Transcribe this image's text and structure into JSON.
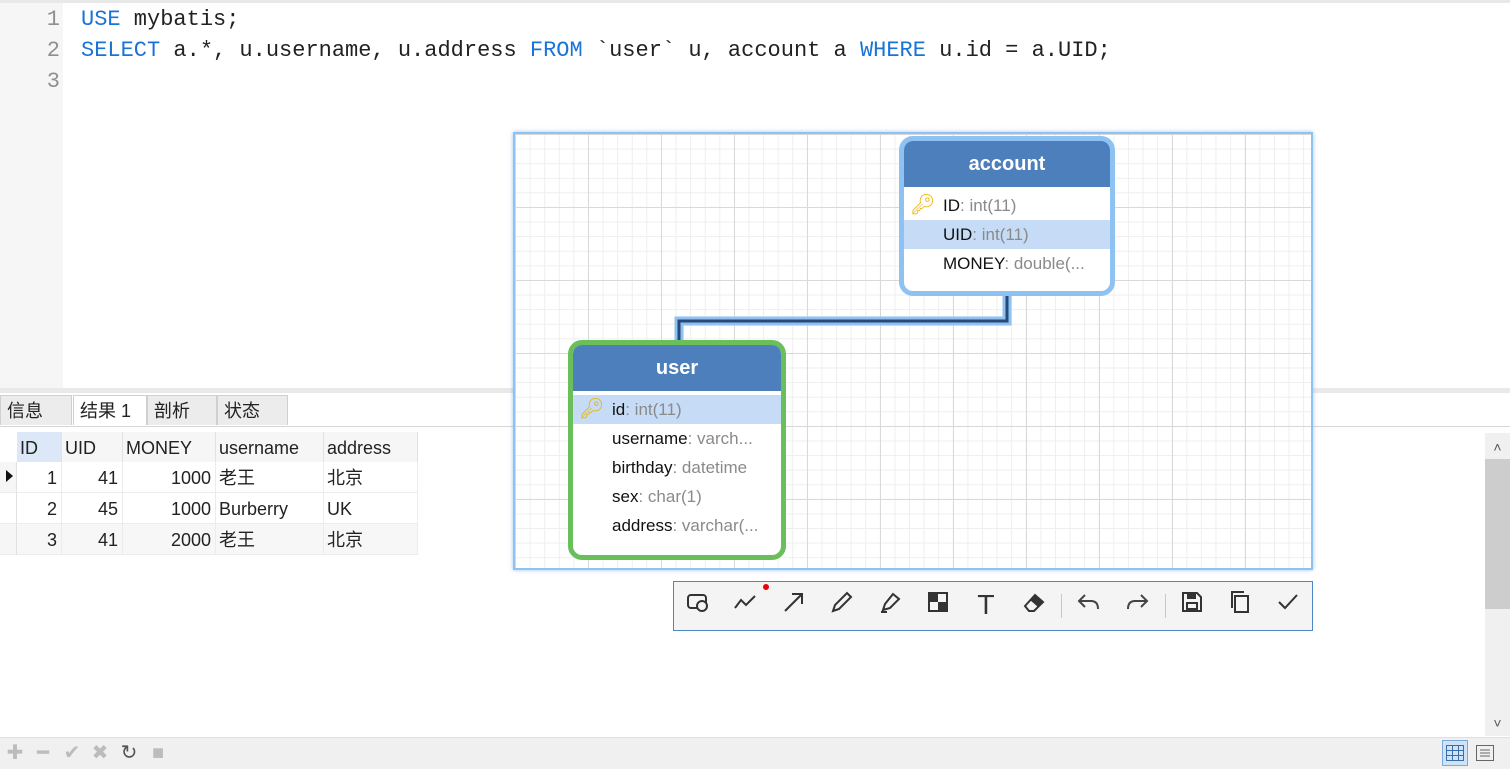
{
  "editor": {
    "line_numbers": [
      "1",
      "2",
      "3"
    ],
    "line1": {
      "kw": "USE",
      "rest": " mybatis;"
    },
    "line2": {
      "kw1": "SELECT",
      "p1": " a.*, u.username, u.address ",
      "kw2": "FROM",
      "p2": " `user` u, account a ",
      "kw3": "WHERE",
      "p3": " u.id = a.UID;"
    }
  },
  "tabs": [
    {
      "label": "信息",
      "active": false
    },
    {
      "label": "结果 1",
      "active": true
    },
    {
      "label": "剖析",
      "active": false
    },
    {
      "label": "状态",
      "active": false
    }
  ],
  "grid": {
    "columns": [
      "ID",
      "UID",
      "MONEY",
      "username",
      "address"
    ],
    "rows": [
      {
        "id": "1",
        "uid": "41",
        "money": "1000",
        "username": "老王",
        "address": "北京"
      },
      {
        "id": "2",
        "uid": "45",
        "money": "1000",
        "username": "Burberry",
        "address": "UK"
      },
      {
        "id": "3",
        "uid": "41",
        "money": "2000",
        "username": "老王",
        "address": "北京"
      }
    ]
  },
  "diagram": {
    "account": {
      "title": "account",
      "fields": [
        {
          "name": "ID",
          "type": ": int(11)",
          "primary_key": true
        },
        {
          "name": "UID",
          "type": ": int(11)",
          "primary_key": false
        },
        {
          "name": "MONEY",
          "type": ": double(...",
          "primary_key": false
        }
      ],
      "border_color": "#8ec2f2"
    },
    "user": {
      "title": "user",
      "fields": [
        {
          "name": "id",
          "type": ": int(11)",
          "primary_key": true
        },
        {
          "name": "username",
          "type": ": varch...",
          "primary_key": false
        },
        {
          "name": "birthday",
          "type": ": datetime",
          "primary_key": false
        },
        {
          "name": "sex",
          "type": ": char(1)",
          "primary_key": false
        },
        {
          "name": "address",
          "type": ": varchar(...",
          "primary_key": false
        }
      ],
      "border_color": "#6abf5a"
    },
    "header_color": "#4d7fbd"
  },
  "toolbar_icons": [
    "rect-shape-icon",
    "polyline-icon",
    "arrow-icon",
    "pen-icon",
    "highlighter-icon",
    "mosaic-icon",
    "text-icon",
    "eraser-icon",
    "undo-icon",
    "redo-icon",
    "save-icon",
    "copy-icon",
    "confirm-icon"
  ],
  "bottom_icons": [
    "add-icon",
    "remove-icon",
    "apply-icon",
    "discard-icon",
    "refresh-icon",
    "stop-icon",
    "grid-view-icon",
    "form-view-icon"
  ]
}
